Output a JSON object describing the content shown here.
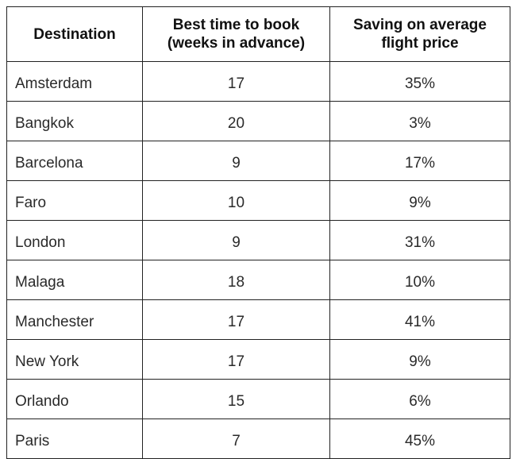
{
  "table": {
    "headers": [
      "Destination",
      "Best time to book (weeks in advance)",
      "Saving on average flight price"
    ],
    "header_lines": [
      [
        "Destination"
      ],
      [
        "Best time to book",
        "(weeks in advance)"
      ],
      [
        "Saving on average",
        "flight price"
      ]
    ],
    "rows": [
      [
        "Amsterdam",
        "17",
        "35%"
      ],
      [
        "Bangkok",
        "20",
        "3%"
      ],
      [
        "Barcelona",
        "9",
        "17%"
      ],
      [
        "Faro",
        "10",
        "9%"
      ],
      [
        "London",
        "9",
        "31%"
      ],
      [
        "Malaga",
        "18",
        "10%"
      ],
      [
        "Manchester",
        "17",
        "41%"
      ],
      [
        "New York",
        "17",
        "9%"
      ],
      [
        "Orlando",
        "15",
        "6%"
      ],
      [
        "Paris",
        "7",
        "45%"
      ]
    ]
  }
}
